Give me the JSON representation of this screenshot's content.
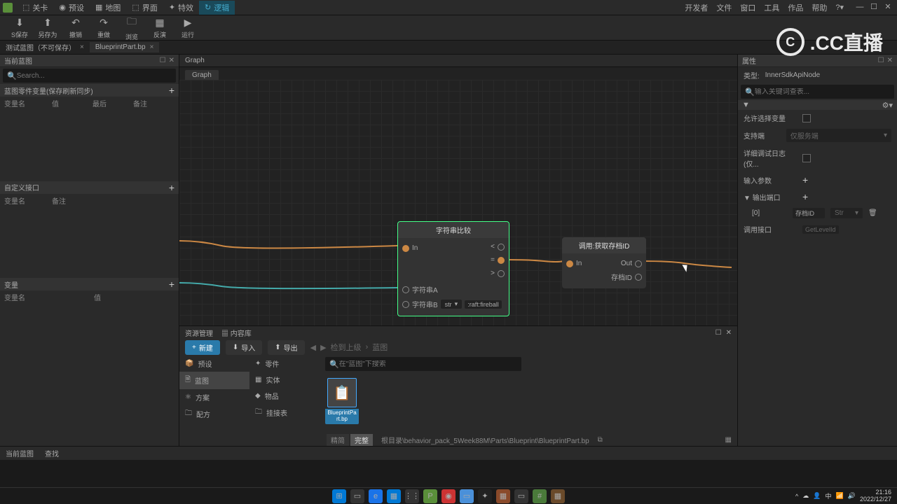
{
  "menubar": {
    "items": [
      "关卡",
      "预设",
      "地图",
      "界面",
      "特效",
      "逻辑"
    ],
    "right": [
      "开发者",
      "文件",
      "窗口",
      "工具",
      "作品",
      "帮助"
    ]
  },
  "toolbar": {
    "save": "S保存",
    "saveas": "另存为",
    "undo": "撤销",
    "redo": "重做",
    "browse": "浏览",
    "reverse": "反演",
    "run": "运行"
  },
  "doc_tabs": [
    {
      "label": "测试蓝图（不可保存）",
      "close": "×"
    },
    {
      "label": "BlueprintPart.bp",
      "close": "×"
    }
  ],
  "left": {
    "header": "当前蓝图",
    "search_ph": "Search...",
    "section1": "蓝图零件变量(保存刷新同步)",
    "cols1": [
      "变量名",
      "值",
      "最后",
      "备注"
    ],
    "section2": "自定义接口",
    "cols2": [
      "变量名",
      "备注"
    ],
    "section3": "变量",
    "cols3": [
      "变量名",
      "值"
    ]
  },
  "graph": {
    "title": "Graph",
    "tab": "Graph",
    "node1": {
      "title": "字符串比较",
      "in": "In",
      "lt": "<",
      "eq": "=",
      "gt": ">",
      "strA": "字符串A",
      "strB": "字符串B",
      "type": "str",
      "val": ":raft:fireball"
    },
    "node2": {
      "title": "调用:获取存档ID",
      "in": "In",
      "out": "Out",
      "save": "存档ID"
    }
  },
  "assets": {
    "tab1": "资源管理",
    "tab2": "内容库",
    "new": "新建",
    "import": "导入",
    "export": "导出",
    "crumb1": "检到上级",
    "crumb2": "蓝图",
    "search_ph": "在\"蓝图\"下搜索",
    "side1": [
      "预设",
      "蓝图",
      "方案",
      "配方"
    ],
    "side2": [
      "零件",
      "实体",
      "物品",
      "挂接表"
    ],
    "item": "BlueprintPart.bp",
    "seg1": "精简",
    "seg2": "完整",
    "path": "根目录\\behavior_pack_5Week88M\\Parts\\Blueprint\\BlueprintPart.bp"
  },
  "right": {
    "header": "属性",
    "type_lbl": "类型:",
    "type_val": "InnerSdkApiNode",
    "search_ph": "输入关键词查表...",
    "allow_var": "允许选择变量",
    "support": "支持端",
    "support_val": "仅服务端",
    "detail": "详细调试日志(仅...",
    "in_params": "输入参数",
    "out_ports": "输出端口",
    "idx": "[0]",
    "saveid": "存档ID",
    "type_str": "Str",
    "call_intf": "调用接口",
    "getlevel": "GetLevelId"
  },
  "status": {
    "current": "当前蓝图",
    "find": "查找"
  },
  "tray": {
    "time": "21:16",
    "date": "2022/12/27",
    "ime": "中"
  }
}
